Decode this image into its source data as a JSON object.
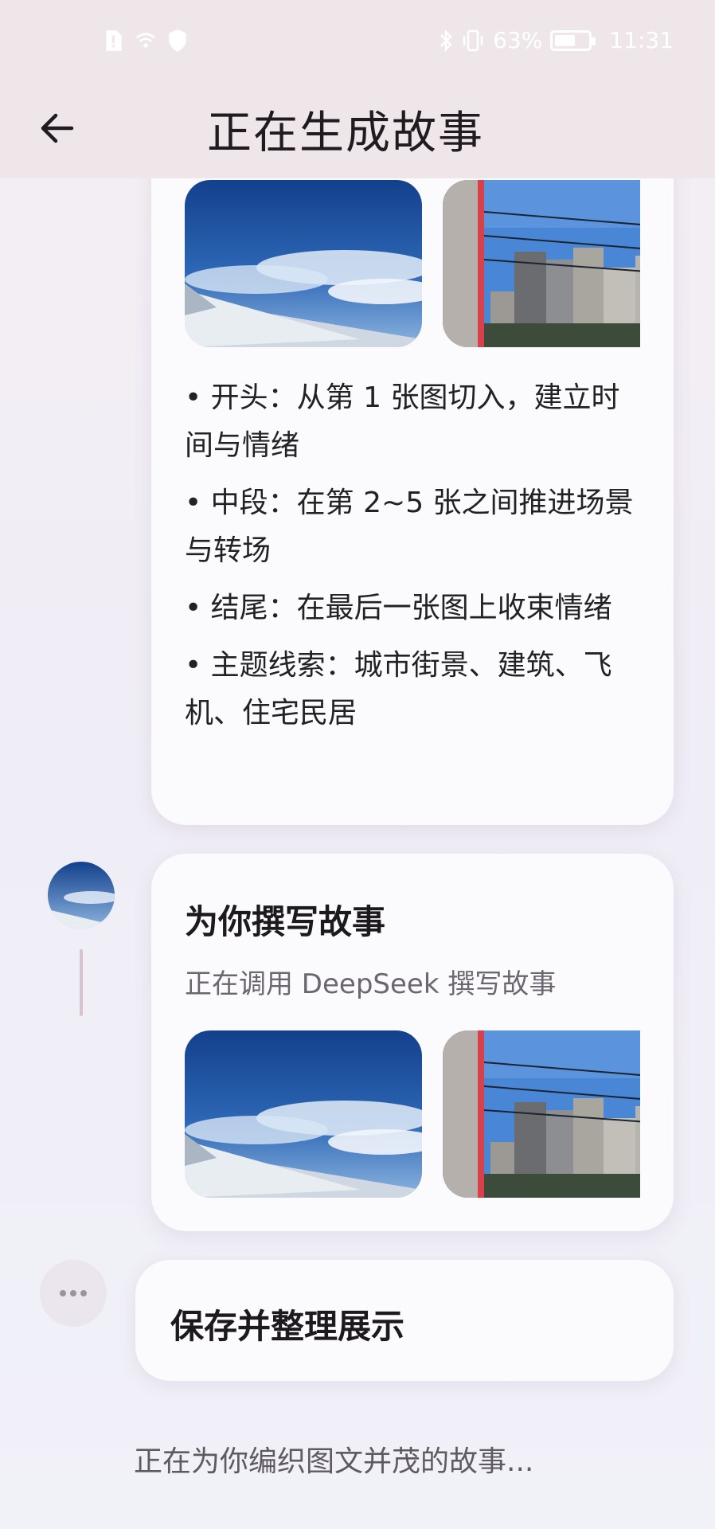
{
  "status_bar": {
    "battery_percent": "63%",
    "battery_level": 0.63,
    "time": "11:31",
    "icons": [
      "sim-icon",
      "wifi-icon",
      "shield-icon",
      "bluetooth-icon",
      "vibrate-icon"
    ]
  },
  "header": {
    "title": "正在生成故事",
    "back_icon": "arrow-left-icon"
  },
  "plan_card": {
    "bullets": [
      "• 开头：从第 1 张图切入，建立时间与情绪",
      "• 中段：在第 2~5 张之间推进场景与转场",
      "• 结尾：在最后一张图上收束情绪",
      "• 主题线索：城市街景、建筑、飞机、住宅民居"
    ]
  },
  "write_card": {
    "title": "为你撰写故事",
    "subtitle": "正在调用 DeepSeek 撰写故事"
  },
  "save_card": {
    "title": "保存并整理展示"
  },
  "footer": {
    "status_text": "正在为你编织图文并茂的故事..."
  },
  "colors": {
    "header_bg": "#efe6ea",
    "card_bg": "#fbfbfd",
    "timeline": "#d8c3cc"
  }
}
